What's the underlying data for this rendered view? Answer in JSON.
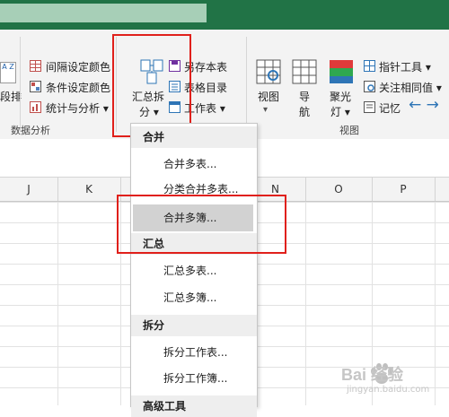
{
  "ribbon": {
    "left_partial": {
      "line1": "段排",
      "icon_letter": "A Z"
    },
    "analysis_group": {
      "items": [
        {
          "label": "间隔设定颜色"
        },
        {
          "label": "条件设定颜色"
        },
        {
          "label": "统计与分析",
          "suffix": "▾"
        }
      ],
      "group_label": "数据分析"
    },
    "summary_split": {
      "line1": "汇总拆",
      "line2": "分 ▾"
    },
    "save_group": {
      "items": [
        {
          "label": "另存本表"
        },
        {
          "label": "表格目录"
        },
        {
          "label": "工作表",
          "suffix": "▾"
        }
      ]
    },
    "view_group": {
      "view_label": "视图",
      "nav_label": "导",
      "nav_label2": "航",
      "spotlight_label": "聚光",
      "spotlight_label2": "灯 ▾",
      "small_items": [
        {
          "label": "指针工具",
          "suffix": "▾"
        },
        {
          "label": "关注相同值",
          "suffix": "▾"
        },
        {
          "label": "记忆"
        }
      ],
      "group_label": "视图",
      "arrows": "← →"
    }
  },
  "columns": [
    "J",
    "K",
    "N",
    "O",
    "P"
  ],
  "menu": {
    "sections": [
      {
        "header": "合并",
        "items": [
          "合并多表...",
          "分类合并多表...",
          "合并多簿..."
        ]
      },
      {
        "header": "汇总",
        "items": [
          "汇总多表...",
          "汇总多簿..."
        ]
      },
      {
        "header": "拆分",
        "items": [
          "拆分工作表...",
          "拆分工作簿..."
        ]
      },
      {
        "header": "高级工具"
      }
    ],
    "highlighted": "合并多簿..."
  },
  "watermark": {
    "text": "Bai 经验",
    "sub": "jingyan.baidu.com"
  },
  "colors": {
    "title_bar": "#217346",
    "highlight_box": "#e0201b",
    "hover": "#d2d2d2"
  }
}
